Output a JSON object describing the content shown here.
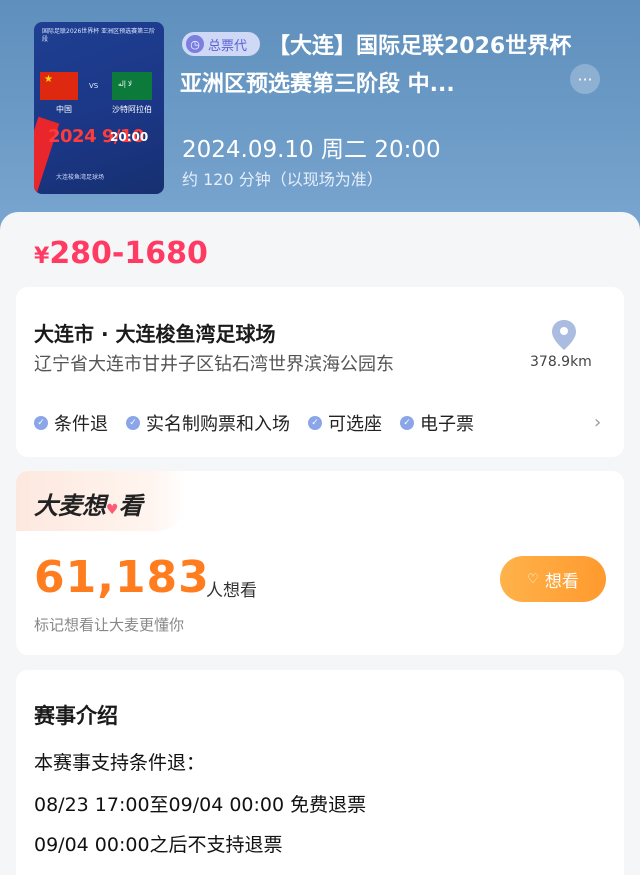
{
  "poster": {
    "title_line": "国际足联2026世界杯 亚洲区预选赛第三阶段",
    "team_home": "中国",
    "team_away": "沙特阿拉伯",
    "date": "2024 9/10",
    "time": "20:00",
    "venue_small": "大连梭鱼湾足球场"
  },
  "header": {
    "badge_label": "总票代",
    "title": "【大连】国际足联2026世界杯亚洲区预选赛第三阶段 中...",
    "more_label": "···",
    "datetime": "2024.09.10 周二 20:00",
    "duration": "约 120 分钟（以现场为准）"
  },
  "price": {
    "currency": "¥",
    "range": "280-1680"
  },
  "venue": {
    "name": "大连市 · 大连梭鱼湾足球场",
    "address": "辽宁省大连市甘井子区钻石湾世界滨海公园东",
    "distance": "378.9km",
    "tags": [
      "条件退",
      "实名制购票和入场",
      "可选座",
      "电子票"
    ]
  },
  "want": {
    "title_a": "大麦想",
    "title_b": "看",
    "count": "61,183",
    "unit": "人想看",
    "hint": "标记想看让大麦更懂你",
    "button_label": "想看"
  },
  "intro": {
    "title": "赛事介绍",
    "lines": [
      "本赛事支持条件退：",
      "08/23 17:00至09/04 00:00 免费退票",
      "09/04 00:00之后不支持退票"
    ]
  },
  "colors": {
    "price": "#ff3a63",
    "want_count": "#ff7d1f",
    "want_button": "#ffa63a",
    "header_bg": "#6b9ac6"
  }
}
